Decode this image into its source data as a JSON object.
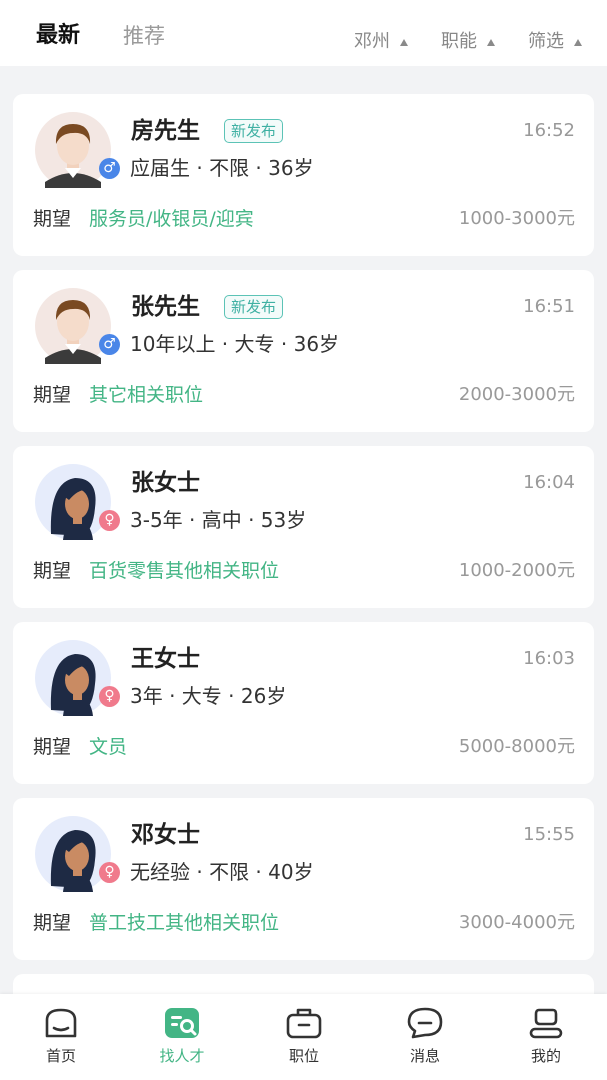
{
  "header": {
    "tabs": [
      {
        "label": "最新",
        "active": true
      },
      {
        "label": "推荐",
        "active": false
      }
    ],
    "filters": [
      {
        "label": "邓州"
      },
      {
        "label": "职能"
      },
      {
        "label": "筛选"
      }
    ]
  },
  "candidates": [
    {
      "name": "房先生",
      "badge": "新发布",
      "time": "16:52",
      "meta": "应届生 · 不限 · 36岁",
      "expect_label": "期望",
      "expect": "服务员/收银员/迎宾",
      "salary": "1000-3000元",
      "gender": "male"
    },
    {
      "name": "张先生",
      "badge": "新发布",
      "time": "16:51",
      "meta": "10年以上 · 大专 · 36岁",
      "expect_label": "期望",
      "expect": "其它相关职位",
      "salary": "2000-3000元",
      "gender": "male"
    },
    {
      "name": "张女士",
      "time": "16:04",
      "meta": "3-5年 · 高中 · 53岁",
      "expect_label": "期望",
      "expect": "百货零售其他相关职位",
      "salary": "1000-2000元",
      "gender": "female"
    },
    {
      "name": "王女士",
      "time": "16:03",
      "meta": "3年 · 大专 · 26岁",
      "expect_label": "期望",
      "expect": "文员",
      "salary": "5000-8000元",
      "gender": "female"
    },
    {
      "name": "邓女士",
      "time": "15:55",
      "meta": "无经验 · 不限 · 40岁",
      "expect_label": "期望",
      "expect": "普工技工其他相关职位",
      "salary": "3000-4000元",
      "gender": "female"
    }
  ],
  "bottom_nav": [
    {
      "label": "首页",
      "icon": "home-icon"
    },
    {
      "label": "找人才",
      "icon": "find-talent-icon",
      "active": true
    },
    {
      "label": "职位",
      "icon": "briefcase-icon"
    },
    {
      "label": "消息",
      "icon": "message-icon"
    },
    {
      "label": "我的",
      "icon": "profile-icon"
    }
  ],
  "colors": {
    "accent": "#43b585",
    "badge": "#3fb0a3",
    "male": "#4a86e8",
    "female": "#f07a8c"
  }
}
